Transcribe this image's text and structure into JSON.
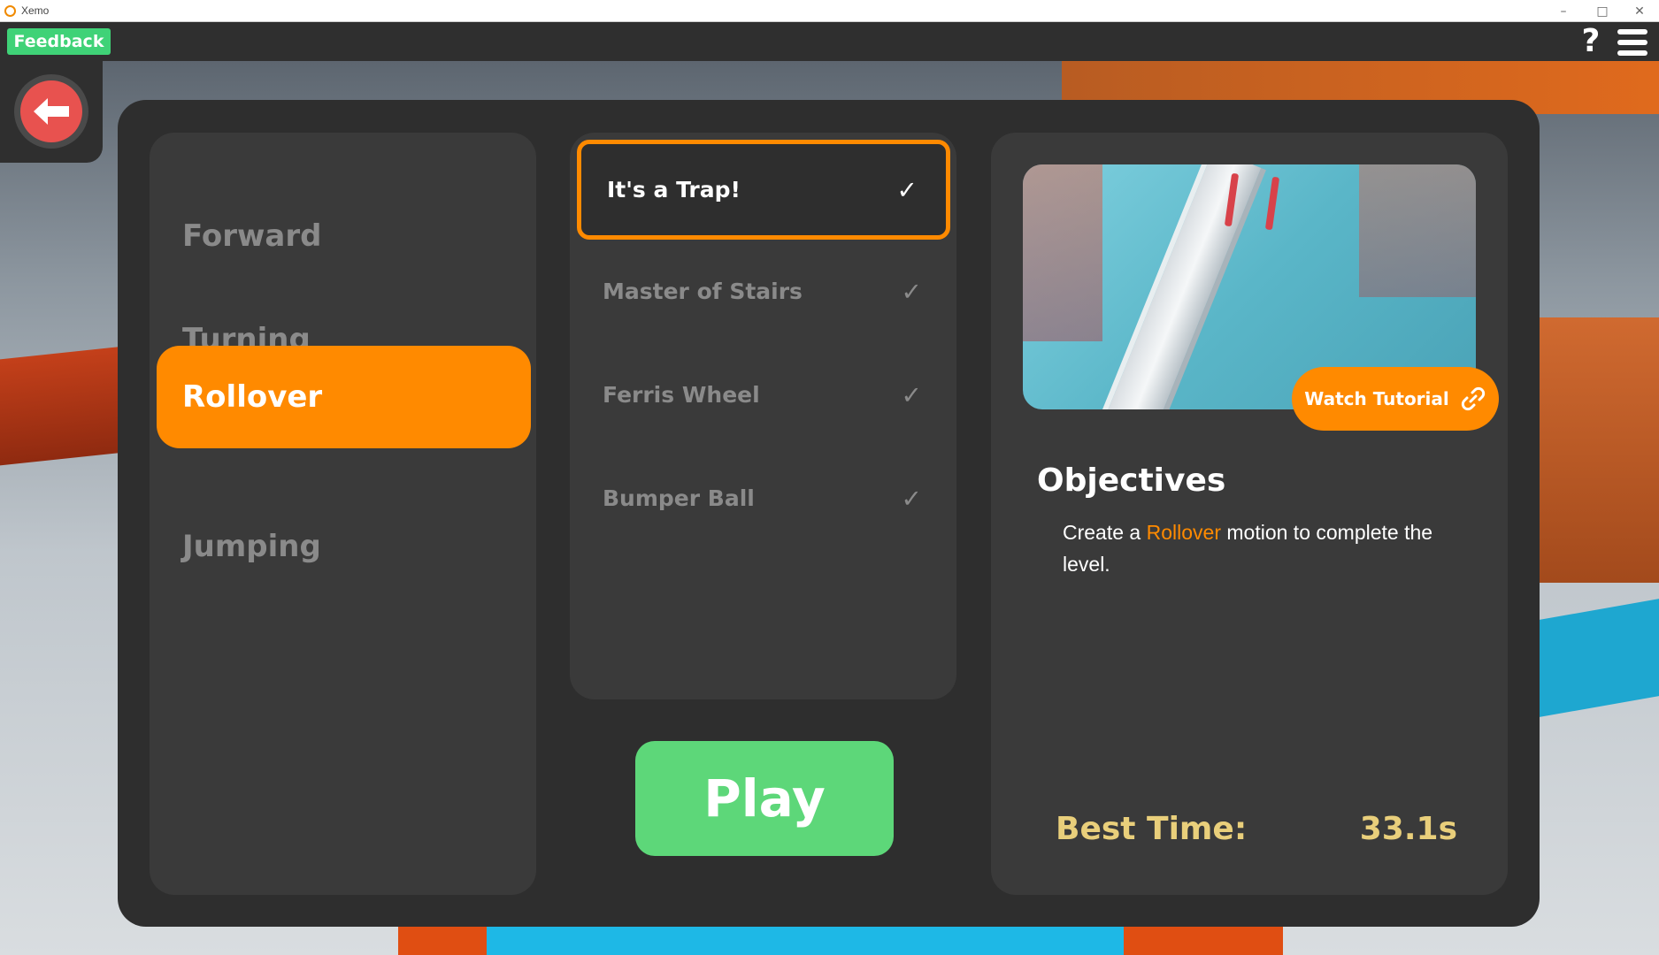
{
  "window": {
    "title": "Xemo",
    "minimize": "–",
    "maximize": "□",
    "close": "✕"
  },
  "topbar": {
    "feedback_label": "Feedback",
    "help_label": "?"
  },
  "categories": [
    {
      "label": "Forward",
      "active": false
    },
    {
      "label": "Turning",
      "active": false
    },
    {
      "label": "Rollover",
      "active": true
    },
    {
      "label": "Jumping",
      "active": false
    }
  ],
  "levels": [
    {
      "label": "It's a Trap!",
      "completed": true,
      "selected": true
    },
    {
      "label": "Master of Stairs",
      "completed": true,
      "selected": false
    },
    {
      "label": "Ferris Wheel",
      "completed": true,
      "selected": false
    },
    {
      "label": "Bumper Ball",
      "completed": true,
      "selected": false
    }
  ],
  "play_label": "Play",
  "info": {
    "watch_tutorial_label": "Watch Tutorial",
    "objectives_title": "Objectives",
    "objective_prefix": "Create a ",
    "objective_highlight": "Rollover",
    "objective_suffix": " motion to complete the level.",
    "best_time_label": "Best Time:",
    "best_time_value": "33.1s"
  },
  "colors": {
    "accent": "#ff8a00",
    "play": "#5dd779",
    "feedback": "#3fd277",
    "back": "#e8524f",
    "best_time": "#e9cf7b",
    "panel": "#2e2e2e",
    "column": "#3a3a3a"
  },
  "icons": {
    "back": "arrow-left-icon",
    "help": "question-icon",
    "menu": "hamburger-menu-icon",
    "check": "check-icon",
    "link": "link-icon"
  }
}
